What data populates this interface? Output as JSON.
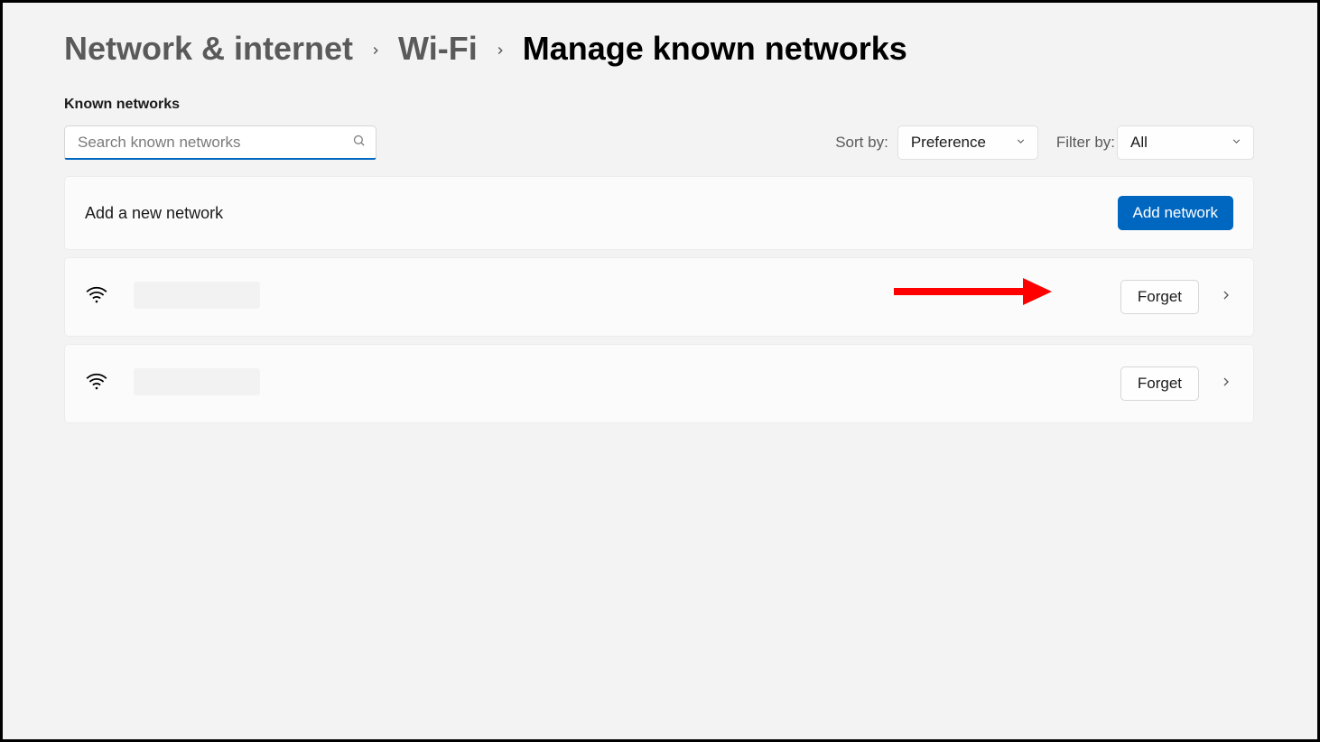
{
  "breadcrumb": {
    "root": "Network & internet",
    "mid": "Wi-Fi",
    "current": "Manage known networks"
  },
  "section_label": "Known networks",
  "search": {
    "placeholder": "Search known networks"
  },
  "sort": {
    "label": "Sort by:",
    "value": "Preference"
  },
  "filter": {
    "label": "Filter by:",
    "value": "All"
  },
  "add_card": {
    "title": "Add a new network",
    "button": "Add network"
  },
  "networks": [
    {
      "forget": "Forget"
    },
    {
      "forget": "Forget"
    }
  ]
}
